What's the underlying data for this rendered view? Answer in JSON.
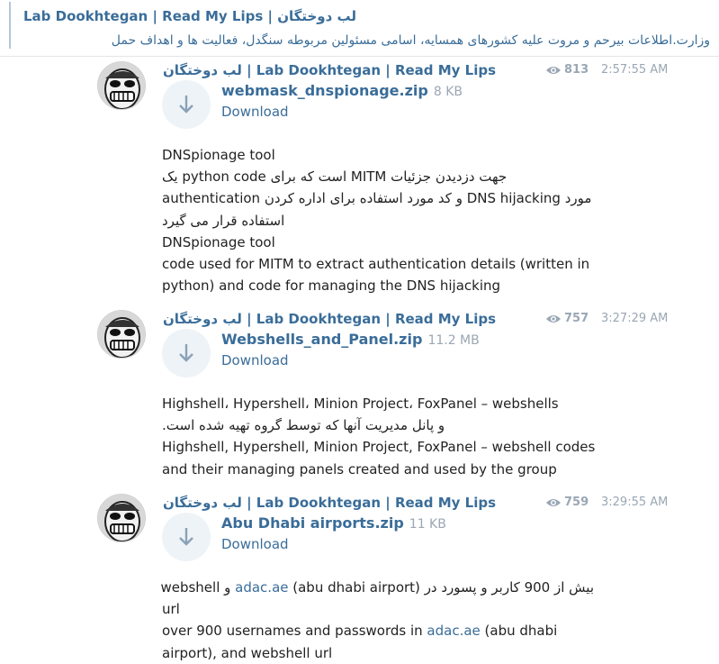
{
  "header": {
    "title": "لب دوختگان | Lab Dookhtegan | Read My Lips",
    "subtitle": "وزارت.اطلاعات بیرحم و مروت علیه کشورهای همسایه، اسامی مسئولین مربوطه سنگدل، فعالیت ها و اهداف حمل"
  },
  "messages": [
    {
      "sender": "لب دوختگان | Lab Dookhtegan | Read My Lips",
      "views": "813",
      "time": "2:57:55 AM",
      "file_name": "webmask_dnspionage.zip",
      "file_size": "8 KB",
      "download_label": "Download",
      "lines": [
        "DNSpionage tool",
        "جهت دزدیدن جزئیات MITM است که برای python code یک",
        "مورد DNS hijacking و کد مورد استفاده برای اداره کردن authentication",
        "استفاده قرار می گیرد",
        "DNSpionage tool",
        "code used for MITM to extract authentication details (written in",
        "python) and code for managing the DNS hijacking"
      ]
    },
    {
      "sender": "لب دوختگان | Lab Dookhtegan | Read My Lips",
      "views": "757",
      "time": "3:27:29 AM",
      "file_name": "Webshells_and_Panel.zip",
      "file_size": "11.2 MB",
      "download_label": "Download",
      "lines": [
        "Highshell، Hypershell، Minion Project، FoxPanel – webshells",
        "و پانل مدیریت آنها که توسط گروه تهیه شده است.",
        "Highshell, Hypershell, Minion Project, FoxPanel – webshell codes",
        "and their managing panels created and used by the group"
      ]
    },
    {
      "sender": "لب دوختگان | Lab Dookhtegan | Read My Lips",
      "views": "759",
      "time": "3:29:55 AM",
      "file_name": "Abu Dhabi airports.zip",
      "file_size": "11 KB",
      "download_label": "Download",
      "lines_a": {
        "pre": "بیش از 900 کاربر و پسورد در ",
        "link": "adac.ae",
        "post": " (abu dhabi airport) و webshell"
      },
      "line_url": "url",
      "lines_b": {
        "pre": "over 900 usernames and passwords in ",
        "link": "adac.ae",
        "post": " (abu dhabi"
      },
      "line_last": "airport), and webshell url"
    }
  ]
}
